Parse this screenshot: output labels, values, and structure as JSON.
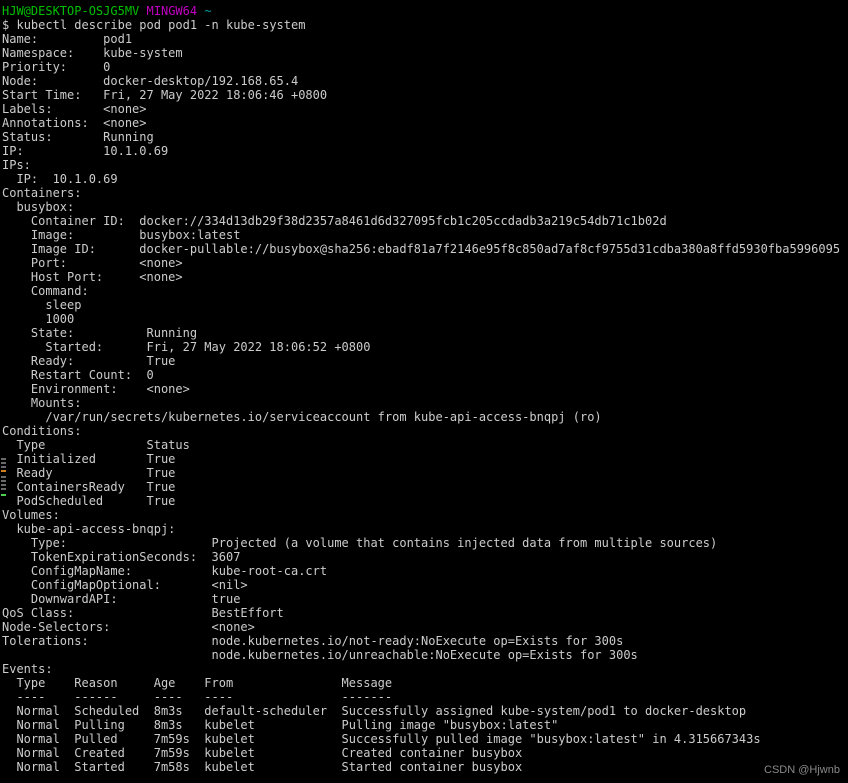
{
  "terminal": {
    "shell_title": "MINGW64",
    "prompt": {
      "user_host": "HJW@DESKTOP-OSJG5MV",
      "shell": "MINGW64",
      "cwd": "~",
      "symbol": "$",
      "command": "kubectl describe pod pod1 -n kube-system"
    },
    "colors": {
      "background": "#000000",
      "foreground": "#cccccc",
      "user_host": "#00c000",
      "shell": "#c000c0",
      "cwd": "#00a0a0",
      "watermark": "#8a8a8a",
      "mark_gray": "#6a6a6a",
      "mark_orange": "#d08020",
      "mark_green": "#50d050"
    },
    "output_lines": [
      "Name:         pod1",
      "Namespace:    kube-system",
      "Priority:     0",
      "Node:         docker-desktop/192.168.65.4",
      "Start Time:   Fri, 27 May 2022 18:06:46 +0800",
      "Labels:       <none>",
      "Annotations:  <none>",
      "Status:       Running",
      "IP:           10.1.0.69",
      "IPs:",
      "  IP:  10.1.0.69",
      "Containers:",
      "  busybox:",
      "    Container ID:  docker://334d13db29f38d2357a8461d6d327095fcb1c205ccdadb3a219c54db71c1b02d",
      "    Image:         busybox:latest",
      "    Image ID:      docker-pullable://busybox@sha256:ebadf81a7f2146e95f8c850ad7af8cf9755d31cdba380a8ffd5930fba5996095",
      "    Port:          <none>",
      "    Host Port:     <none>",
      "    Command:",
      "      sleep",
      "      1000",
      "    State:          Running",
      "      Started:      Fri, 27 May 2022 18:06:52 +0800",
      "    Ready:          True",
      "    Restart Count:  0",
      "    Environment:    <none>",
      "    Mounts:",
      "      /var/run/secrets/kubernetes.io/serviceaccount from kube-api-access-bnqpj (ro)",
      "Conditions:",
      "  Type              Status",
      "  Initialized       True",
      "  Ready             True",
      "  ContainersReady   True",
      "  PodScheduled      True",
      "Volumes:",
      "  kube-api-access-bnqpj:",
      "    Type:                    Projected (a volume that contains injected data from multiple sources)",
      "    TokenExpirationSeconds:  3607",
      "    ConfigMapName:           kube-root-ca.crt",
      "    ConfigMapOptional:       <nil>",
      "    DownwardAPI:             true",
      "QoS Class:                   BestEffort",
      "Node-Selectors:              <none>",
      "Tolerations:                 node.kubernetes.io/not-ready:NoExecute op=Exists for 300s",
      "                             node.kubernetes.io/unreachable:NoExecute op=Exists for 300s",
      "Events:",
      "  Type    Reason     Age    From               Message",
      "  ----    ------     ----   ----               -------",
      "  Normal  Scheduled  8m3s   default-scheduler  Successfully assigned kube-system/pod1 to docker-desktop",
      "  Normal  Pulling    8m3s   kubelet            Pulling image \"busybox:latest\"",
      "  Normal  Pulled     7m59s  kubelet            Successfully pulled image \"busybox:latest\" in 4.315667343s",
      "  Normal  Created    7m59s  kubelet            Created container busybox",
      "  Normal  Started    7m58s  kubelet            Started container busybox"
    ],
    "pod": {
      "name": "pod1",
      "namespace": "kube-system",
      "priority": "0",
      "node": "docker-desktop/192.168.65.4",
      "start_time": "Fri, 27 May 2022 18:06:46 +0800",
      "labels": "<none>",
      "annotations": "<none>",
      "status": "Running",
      "ip": "10.1.0.69",
      "qos_class": "BestEffort",
      "node_selectors": "<none>",
      "tolerations": [
        "node.kubernetes.io/not-ready:NoExecute op=Exists for 300s",
        "node.kubernetes.io/unreachable:NoExecute op=Exists for 300s"
      ]
    },
    "container": {
      "name": "busybox",
      "container_id": "docker://334d13db29f38d2357a8461d6d327095fcb1c205ccdadb3a219c54db71c1b02d",
      "image": "busybox:latest",
      "image_id": "docker-pullable://busybox@sha256:ebadf81a7f2146e95f8c850ad7af8cf9755d31cdba380a8ffd5930fba5996095",
      "port": "<none>",
      "host_port": "<none>",
      "command": [
        "sleep",
        "1000"
      ],
      "state": "Running",
      "started": "Fri, 27 May 2022 18:06:52 +0800",
      "ready": "True",
      "restart_count": "0",
      "environment": "<none>",
      "mounts": "/var/run/secrets/kubernetes.io/serviceaccount from kube-api-access-bnqpj (ro)"
    },
    "conditions": {
      "headers": [
        "Type",
        "Status"
      ],
      "rows": [
        [
          "Initialized",
          "True"
        ],
        [
          "Ready",
          "True"
        ],
        [
          "ContainersReady",
          "True"
        ],
        [
          "PodScheduled",
          "True"
        ]
      ]
    },
    "volume": {
      "name": "kube-api-access-bnqpj",
      "type": "Projected (a volume that contains injected data from multiple sources)",
      "token_expiration_seconds": "3607",
      "config_map_name": "kube-root-ca.crt",
      "config_map_optional": "<nil>",
      "downward_api": "true"
    },
    "events": {
      "headers": [
        "Type",
        "Reason",
        "Age",
        "From",
        "Message"
      ],
      "rows": [
        [
          "Normal",
          "Scheduled",
          "8m3s",
          "default-scheduler",
          "Successfully assigned kube-system/pod1 to docker-desktop"
        ],
        [
          "Normal",
          "Pulling",
          "8m3s",
          "kubelet",
          "Pulling image \"busybox:latest\""
        ],
        [
          "Normal",
          "Pulled",
          "7m59s",
          "kubelet",
          "Successfully pulled image \"busybox:latest\" in 4.315667343s"
        ],
        [
          "Normal",
          "Created",
          "7m59s",
          "kubelet",
          "Created container busybox"
        ],
        [
          "Normal",
          "Started",
          "7m58s",
          "kubelet",
          "Started container busybox"
        ]
      ]
    },
    "watermark": "CSDN @Hjwnb"
  }
}
